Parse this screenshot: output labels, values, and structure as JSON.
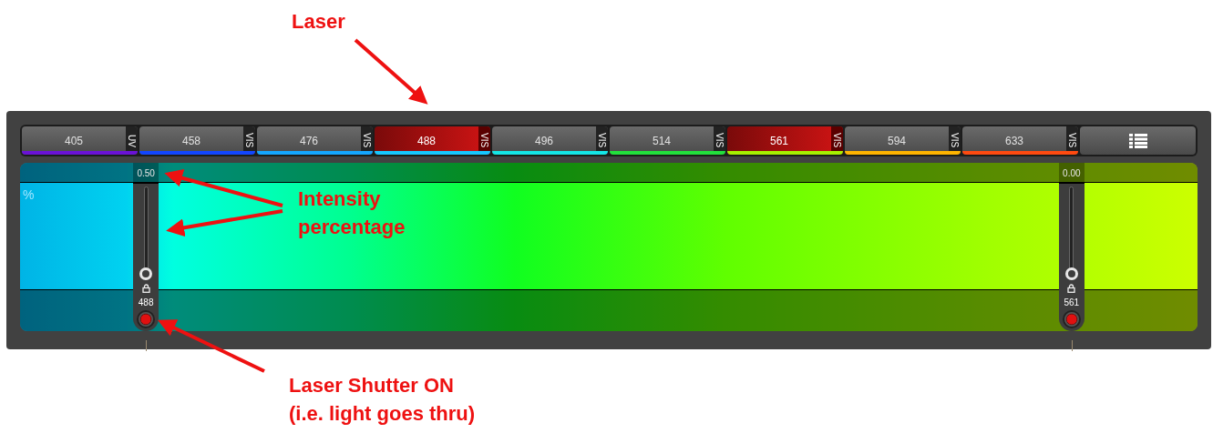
{
  "annotations": [
    {
      "kind": "laser",
      "lines": [
        "Laser"
      ]
    },
    {
      "kind": "intensity",
      "lines": [
        "Intensity",
        "percentage"
      ]
    },
    {
      "kind": "shutter",
      "lines": [
        "Laser Shutter ON",
        "(i.e. light goes thru)"
      ]
    }
  ],
  "laser_tabs": [
    {
      "label": "405",
      "band": "UV",
      "color": "#6a12d6",
      "selected": false
    },
    {
      "label": "458",
      "band": "VIS",
      "color": "#1246ff",
      "selected": false
    },
    {
      "label": "476",
      "band": "VIS",
      "color": "#14a6ff",
      "selected": false
    },
    {
      "label": "488",
      "band": "VIS",
      "color": "#16c8ff",
      "selected": true
    },
    {
      "label": "496",
      "band": "VIS",
      "color": "#14e6e6",
      "selected": false
    },
    {
      "label": "514",
      "band": "VIS",
      "color": "#22e03c",
      "selected": false
    },
    {
      "label": "561",
      "band": "VIS",
      "color": "#a6f000",
      "selected": true
    },
    {
      "label": "594",
      "band": "VIS",
      "color": "#ffb400",
      "selected": false
    },
    {
      "label": "633",
      "band": "VIS",
      "color": "#ff4a10",
      "selected": false
    }
  ],
  "unit_label": "%",
  "channels": [
    {
      "value": "0.50",
      "level": 0.005,
      "label": "488",
      "shutter_on": true
    },
    {
      "value": "0.00",
      "level": 0,
      "label": "561",
      "shutter_on": true
    }
  ]
}
